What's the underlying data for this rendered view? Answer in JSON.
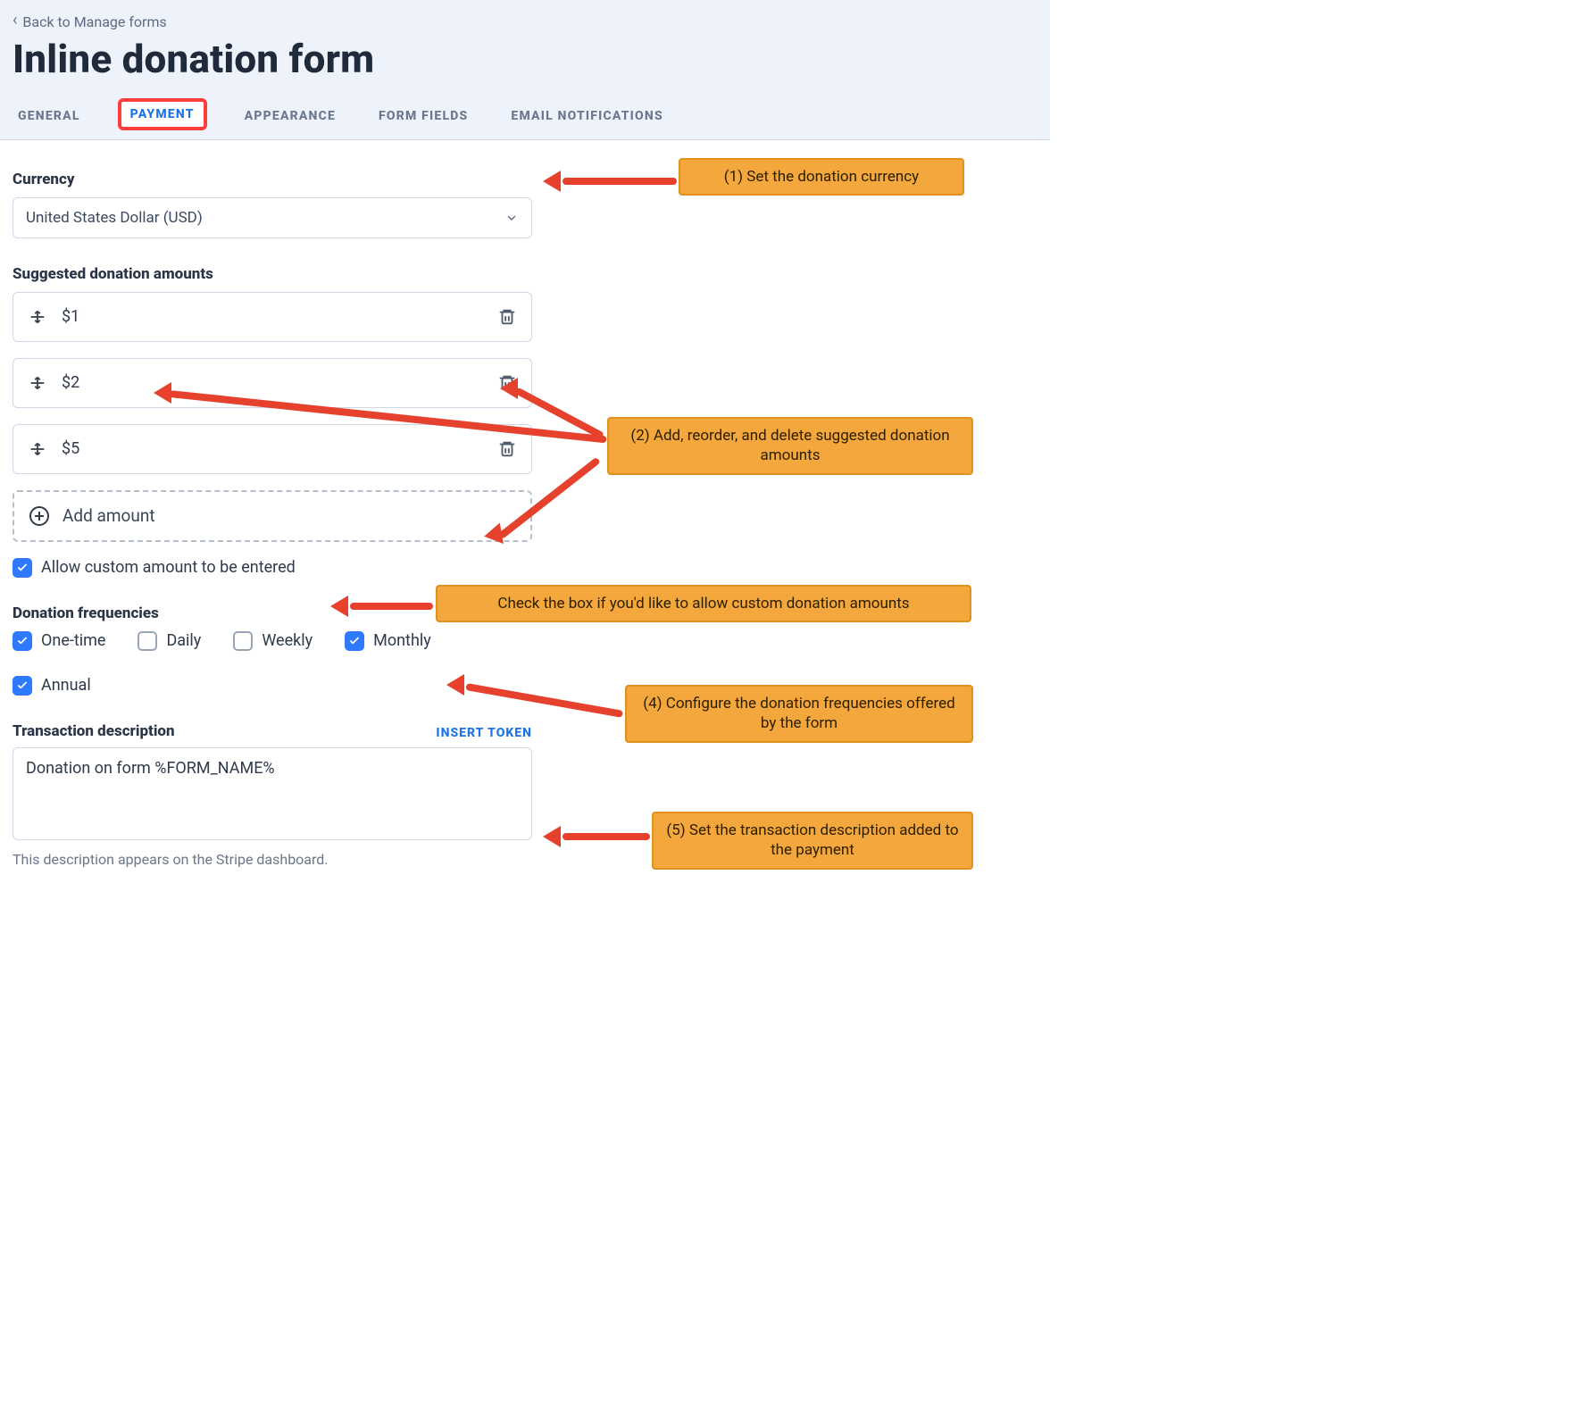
{
  "nav": {
    "back_label": "Back to Manage forms"
  },
  "header": {
    "title": "Inline donation form"
  },
  "tabs": {
    "items": [
      {
        "label": "GENERAL"
      },
      {
        "label": "PAYMENT"
      },
      {
        "label": "APPEARANCE"
      },
      {
        "label": "FORM FIELDS"
      },
      {
        "label": "EMAIL NOTIFICATIONS"
      }
    ],
    "active_index": 1
  },
  "currency": {
    "label": "Currency",
    "selected": "United States Dollar (USD)"
  },
  "suggested": {
    "label": "Suggested donation amounts",
    "items": [
      {
        "text": "$1"
      },
      {
        "text": "$2"
      },
      {
        "text": "$5"
      }
    ],
    "add_label": "Add amount"
  },
  "allow_custom": {
    "checked": true,
    "label": "Allow custom amount to be entered"
  },
  "frequencies": {
    "label": "Donation frequencies",
    "items": [
      {
        "label": "One-time",
        "checked": true
      },
      {
        "label": "Daily",
        "checked": false
      },
      {
        "label": "Weekly",
        "checked": false
      },
      {
        "label": "Monthly",
        "checked": true
      },
      {
        "label": "Annual",
        "checked": true
      }
    ]
  },
  "transaction": {
    "label": "Transaction description",
    "token_action": "INSERT TOKEN",
    "value": "Donation on form %FORM_NAME%",
    "hint": "This description appears on the Stripe dashboard."
  },
  "callouts": {
    "c1": "(1) Set the donation currency",
    "c2": "(2) Add, reorder, and delete suggested donation amounts",
    "c3": "Check the box if you'd like to allow custom donation amounts",
    "c4": "(4) Configure the donation frequencies offered by the form",
    "c5": "(5) Set the transaction description added to the payment"
  }
}
